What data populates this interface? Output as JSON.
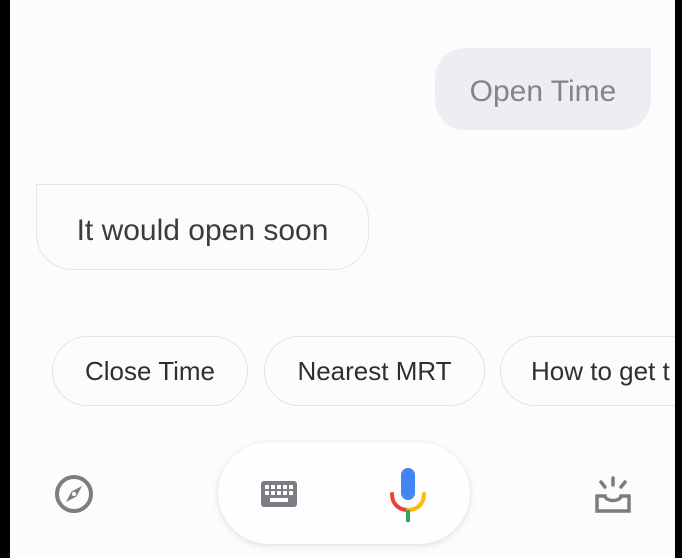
{
  "conversation": {
    "user_message": "Open Time",
    "assistant_message": "It would open soon"
  },
  "suggestions": [
    {
      "label": "Close Time"
    },
    {
      "label": "Nearest MRT"
    },
    {
      "label": "How to get t"
    }
  ],
  "bottom_bar": {
    "explore_icon": "compass-icon",
    "keyboard_icon": "keyboard-icon",
    "mic_icon": "microphone-icon",
    "snapshot_icon": "inbox-sparkle-icon"
  },
  "colors": {
    "user_bubble_bg": "#eeedf1",
    "mic_blue": "#4285f4",
    "mic_red": "#ea4335",
    "mic_yellow": "#fbbc05",
    "mic_green": "#34a853"
  }
}
